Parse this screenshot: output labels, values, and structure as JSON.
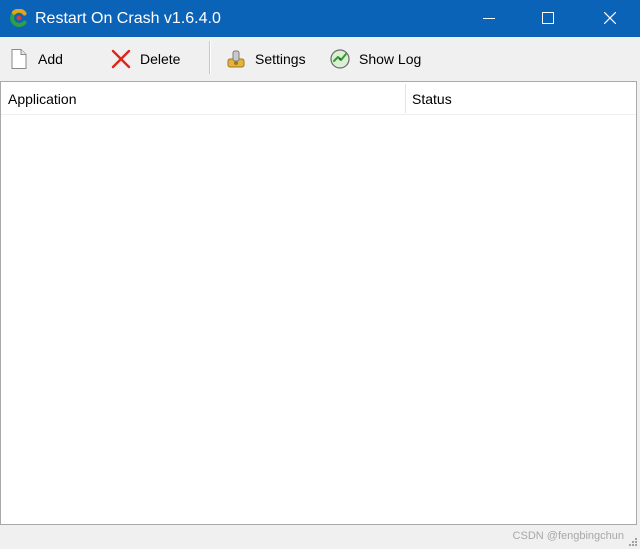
{
  "window": {
    "title": "Restart On Crash v1.6.4.0",
    "app_icon": "app-logo-icon",
    "controls": [
      "minimize-icon",
      "maximize-icon",
      "close-icon"
    ],
    "titlebar_color": "#0b63b8"
  },
  "toolbar": {
    "add_label": "Add",
    "delete_label": "Delete",
    "settings_label": "Settings",
    "showlog_label": "Show Log",
    "icons": {
      "add": "document-icon",
      "delete": "red-x-icon",
      "settings": "settings-icon",
      "showlog": "log-icon"
    }
  },
  "list": {
    "columns": [
      "Application",
      "Status"
    ],
    "rows": []
  },
  "statusbar": {
    "watermark": "CSDN @fengbingchun"
  }
}
